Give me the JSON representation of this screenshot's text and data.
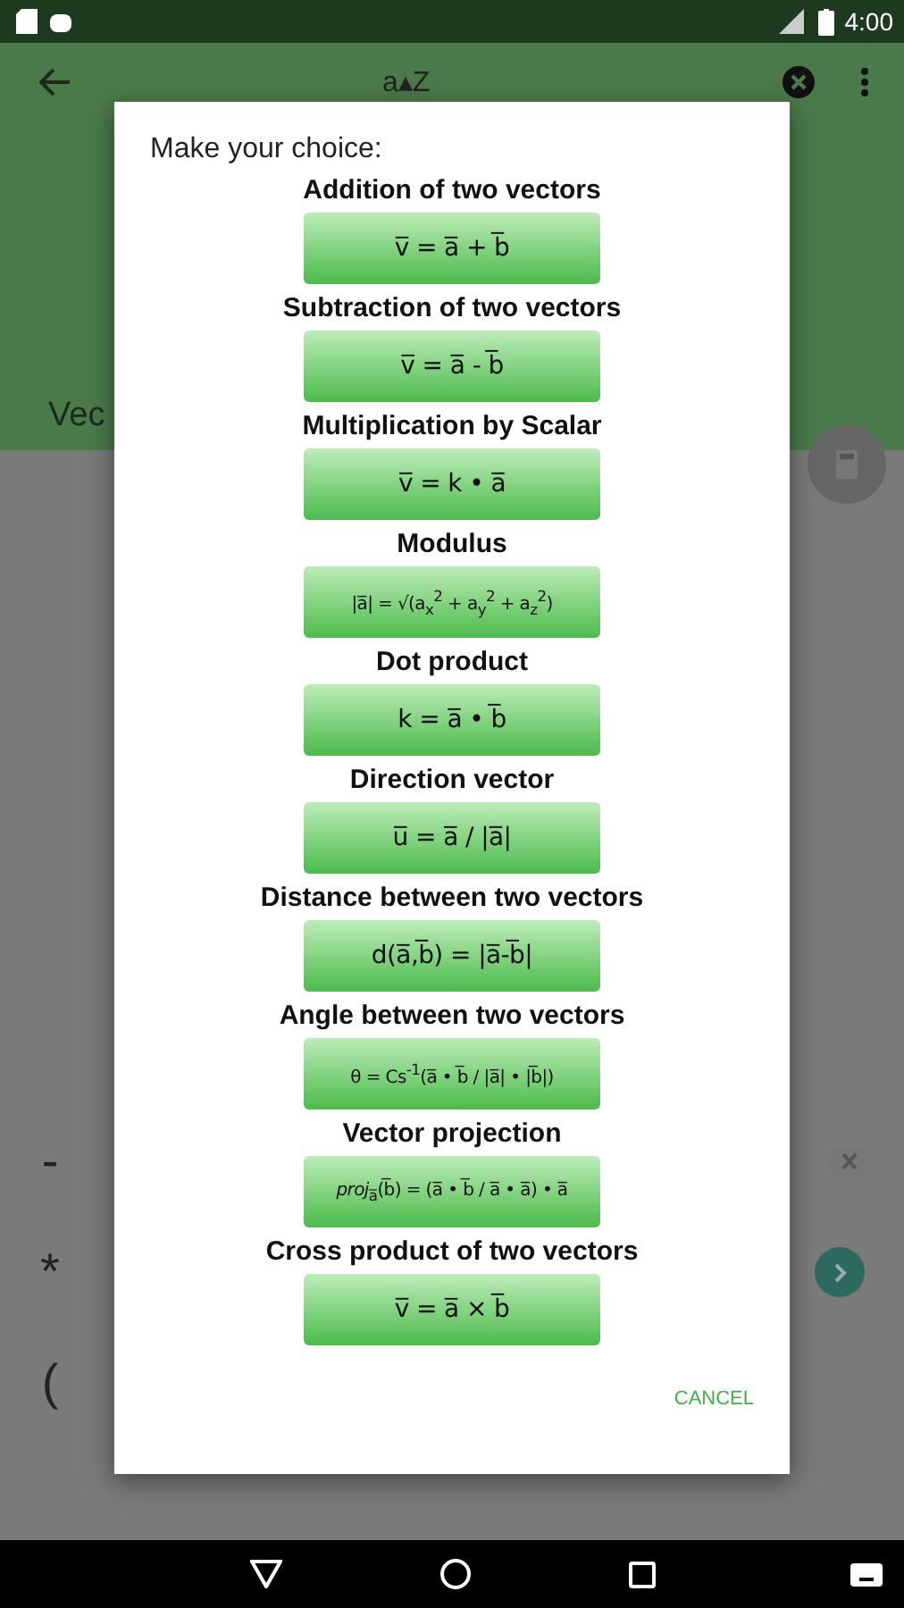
{
  "status_bar": {
    "time": "4:00"
  },
  "app_bar": {
    "title": "a▴Z"
  },
  "section_label": "Vec",
  "keys": [
    "-",
    "*",
    "("
  ],
  "dialog": {
    "title": "Make your choice:",
    "options": [
      {
        "label": "Addition of two vectors",
        "formula": "v̅ = a̅ + b̅"
      },
      {
        "label": "Subtraction of two vectors",
        "formula": "v̅ = a̅ - b̅"
      },
      {
        "label": "Multiplication by Scalar",
        "formula": "v̅ = k • a̅"
      },
      {
        "label": "Modulus",
        "formula": "|a̅| = √(a$_{x}$$^{2}$ + a$_{y}$$^{2}$ + a$_{z}$$^{2}$)"
      },
      {
        "label": "Dot product",
        "formula": "k = a̅ • b̅"
      },
      {
        "label": "Direction vector",
        "formula": "u̅ = a̅ / |a̅|"
      },
      {
        "label": "Distance between two vectors",
        "formula": "d(a̅,b̅) = |a̅-b̅|"
      },
      {
        "label": "Angle between two vectors",
        "formula": "θ = Cs$^{-1}$(a̅ • b̅ / |a̅| • |b̅|)"
      },
      {
        "label": "Vector projection",
        "formula": "*proj*$_{a̅}$(b̅) = (a̅ • b̅ / a̅ • a̅) • a̅"
      },
      {
        "label": "Cross product of two vectors",
        "formula": "v̅ = a̅ × b̅"
      }
    ],
    "cancel": "CANCEL"
  }
}
